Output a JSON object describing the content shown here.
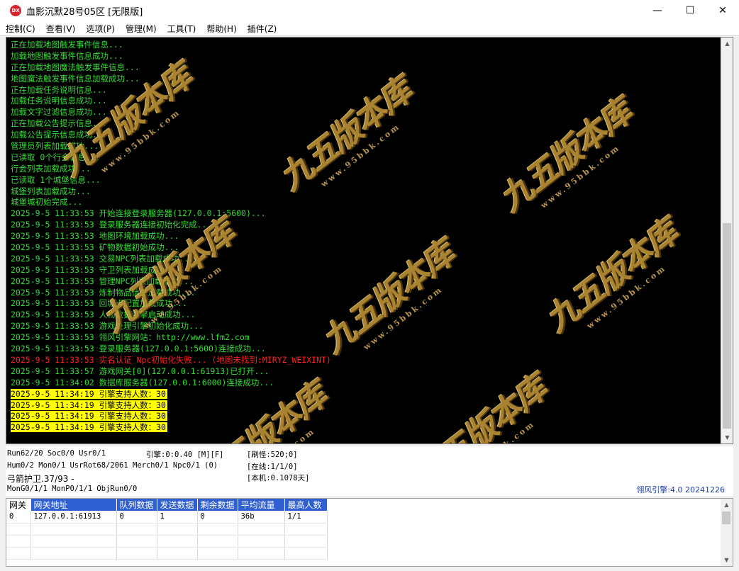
{
  "window": {
    "icon_text": "DX",
    "title": "血影沉默28号05区 [无限版]",
    "minimize_glyph": "—",
    "maximize_glyph": "☐",
    "close_glyph": "✕"
  },
  "menu": [
    {
      "label": "控制(C)"
    },
    {
      "label": "查看(V)"
    },
    {
      "label": "选项(P)"
    },
    {
      "label": "管理(M)"
    },
    {
      "label": "工具(T)"
    },
    {
      "label": "帮助(H)"
    },
    {
      "label": "插件(Z)"
    }
  ],
  "log": [
    {
      "text": "正在加载地图触发事件信息...",
      "kind": "normal"
    },
    {
      "text": "加载地图触发事件信息成功...",
      "kind": "normal"
    },
    {
      "text": "正在加载地图魔法触发事件信息...",
      "kind": "normal"
    },
    {
      "text": "地图魔法触发事件信息加载成功...",
      "kind": "normal"
    },
    {
      "text": "正在加载任务说明信息...",
      "kind": "normal"
    },
    {
      "text": "加载任务说明信息成功...",
      "kind": "normal"
    },
    {
      "text": "加载文字过滤信息成功...",
      "kind": "normal"
    },
    {
      "text": "正在加载公告提示信息...",
      "kind": "normal"
    },
    {
      "text": "加载公告提示信息成功...",
      "kind": "normal"
    },
    {
      "text": "管理员列表加载成功...",
      "kind": "normal"
    },
    {
      "text": "已读取 0个行会信息...",
      "kind": "normal"
    },
    {
      "text": "行会列表加载成功...",
      "kind": "normal"
    },
    {
      "text": "已读取 1个城堡信息...",
      "kind": "normal"
    },
    {
      "text": "城堡列表加载成功...",
      "kind": "normal"
    },
    {
      "text": "城堡城初始完成...",
      "kind": "normal"
    },
    {
      "text": "2025-9-5 11:33:53 开始连接登录服务器(127.0.0.1:5600)...",
      "kind": "normal"
    },
    {
      "text": "2025-9-5 11:33:53 登录服务器连接初始化完成...",
      "kind": "normal"
    },
    {
      "text": "2025-9-5 11:33:53 地图环境加载成功...",
      "kind": "normal"
    },
    {
      "text": "2025-9-5 11:33:53 矿物数据初始成功...",
      "kind": "normal"
    },
    {
      "text": "2025-9-5 11:33:53 交易NPC列表加载成功...",
      "kind": "normal"
    },
    {
      "text": "2025-9-5 11:33:53 守卫列表加载成功...",
      "kind": "normal"
    },
    {
      "text": "2025-9-5 11:33:53 管理NPC列表加载成功...",
      "kind": "normal"
    },
    {
      "text": "2025-9-5 11:33:53 炼制物品信息加载成功...",
      "kind": "normal"
    },
    {
      "text": "2025-9-5 11:33:53 回城点配置加载成功...",
      "kind": "normal"
    },
    {
      "text": "2025-9-5 11:33:53 人物数据引擎启动成功...",
      "kind": "normal"
    },
    {
      "text": "2025-9-5 11:33:53 游戏处理引擎初始化成功...",
      "kind": "normal"
    },
    {
      "text": "2025-9-5 11:33:53 翎风引擎网站：http://www.lfm2.com",
      "kind": "normal"
    },
    {
      "text": "2025-9-5 11:33:53 登录服务器(127.0.0.1:5600)连接成功...",
      "kind": "normal"
    },
    {
      "text": "2025-9-5 11:33:53 实名认证 Npc初始化失败... (地图未找到:MIRYZ_WEIXINT)",
      "kind": "error"
    },
    {
      "text": "2025-9-5 11:33:57 游戏网关[0](127.0.0.1:61913)已打开...",
      "kind": "normal"
    },
    {
      "text": "2025-9-5 11:34:02 数据库服务器(127.0.0.1:6000)连接成功...",
      "kind": "normal"
    },
    {
      "text": "2025-9-5 11:34:19 引擎支持人数：30",
      "kind": "highlight"
    },
    {
      "text": "2025-9-5 11:34:19 引擎支持人数：30",
      "kind": "highlight"
    },
    {
      "text": "2025-9-5 11:34:19 引擎支持人数：30",
      "kind": "highlight"
    },
    {
      "text": "2025-9-5 11:34:19 引擎支持人数：30",
      "kind": "highlight"
    }
  ],
  "watermark": {
    "main": "九五版本库",
    "sub": "www.95bbk.com"
  },
  "status": {
    "run": "Run62/20 Soc0/0 Usr0/1",
    "hum": "Hum0/2 Mon0/1 UsrRot68/2061 Merch0/1 Npc0/1 (0)",
    "guard": "弓箭护卫.37/93 -",
    "mon": "MonG0/1/1 MonP0/1/1 ObjRun0/0",
    "engine": "引擎:0:0.40 [M][F]",
    "refresh": "[刷怪:520;0]",
    "online": "[在线:1/1/0]",
    "machine": "[本机:0.1078天]",
    "version": "翎风引擎:4.0 20241226"
  },
  "gateway_table": {
    "columns": [
      "网关",
      "网关地址",
      "队列数据",
      "发送数据",
      "剩余数据",
      "平均流量",
      "最高人数"
    ],
    "rows": [
      [
        "0",
        "127.0.0.1:61913",
        "0",
        "1",
        "0",
        "36b",
        "1/1"
      ]
    ]
  },
  "scroll": {
    "console_up": "▲",
    "console_down": "▼",
    "table_up": "▲",
    "table_down": "▼"
  }
}
